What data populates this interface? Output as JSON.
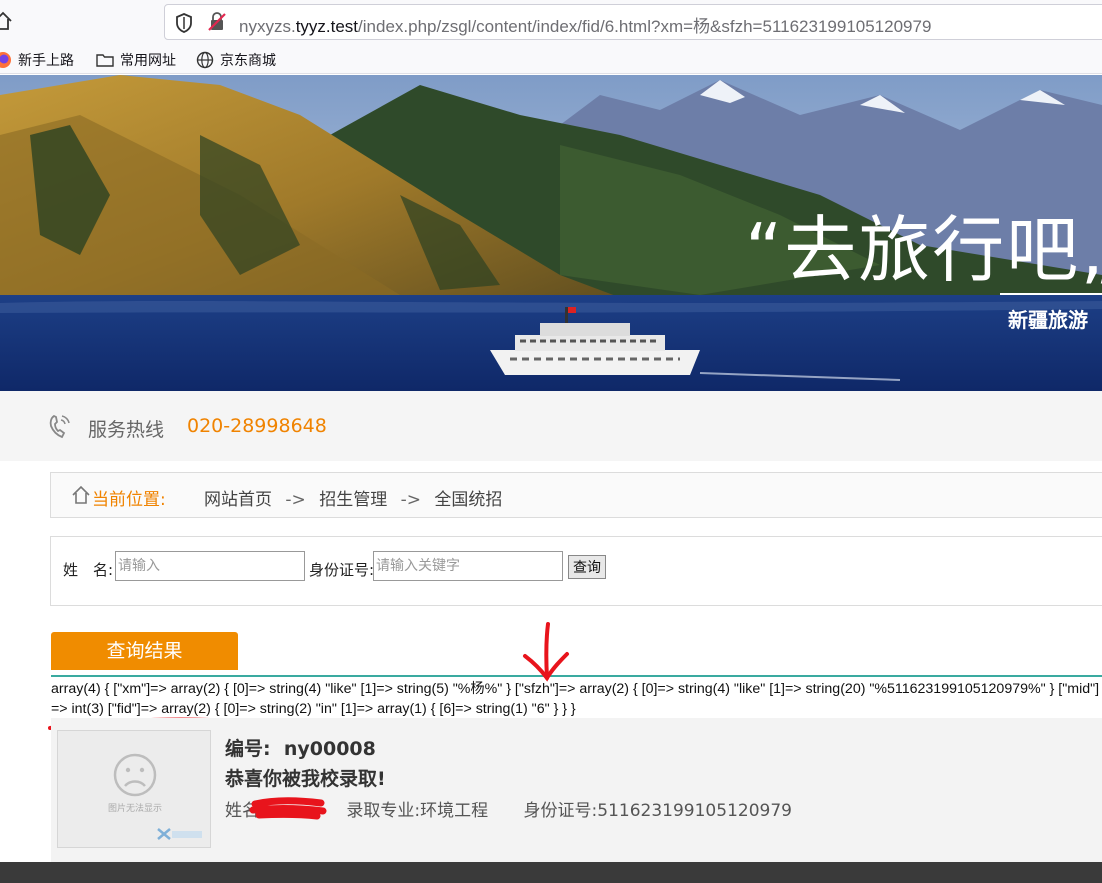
{
  "browser": {
    "url_prefix": "nyxyzs.",
    "url_domain": "tyyz.test",
    "url_path": "/index.php/zsgl/content/index/fid/6.html?xm=杨&sfzh=511623199105120979",
    "bookmarks": [
      {
        "label": "新手上路",
        "icon": "firefox-icon"
      },
      {
        "label": "常用网址",
        "icon": "folder-icon"
      },
      {
        "label": "京东商城",
        "icon": "globe-icon"
      }
    ]
  },
  "banner": {
    "slogan": "“去旅行吧„",
    "sub": "新疆旅游"
  },
  "hotline": {
    "label": "服务热线",
    "number": "020-28998648"
  },
  "breadcrumb": {
    "label": "当前位置:",
    "items": [
      "网站首页",
      "招生管理",
      "全国统招"
    ],
    "separator": "->"
  },
  "search": {
    "name_label": "姓　名:",
    "name_placeholder": "请输入",
    "id_label": "身份证号:",
    "id_placeholder": "请输入关键字",
    "button": "查询"
  },
  "result": {
    "tab_label": "查询结果",
    "debug_output": "array(4) { [\"xm\"]=> array(2) { [0]=> string(4) \"like\" [1]=> string(5) \"%杨%\" } [\"sfzh\"]=> array(2) { [0]=> string(4) \"like\" [1]=> string(20) \"%511623199105120979%\" } [\"mid\"]=> int(3) [\"fid\"]=> array(2) { [0]=> string(2) \"in\" [1]=> array(1) { [6]=> string(1) \"6\" } } }"
  },
  "record": {
    "image_alt": "图片无法显示",
    "id_label": "编号:",
    "id_value": "ny00008",
    "message": "恭喜你被我校录取!",
    "name_label": "姓名:",
    "major": "录取专业:环境工程",
    "idcard": "身份证号:511623199105120979"
  },
  "colors": {
    "accent": "#f08300",
    "tab": "#f08c00",
    "teal_line": "#3aaaa0",
    "annotation": "#e8141c"
  }
}
